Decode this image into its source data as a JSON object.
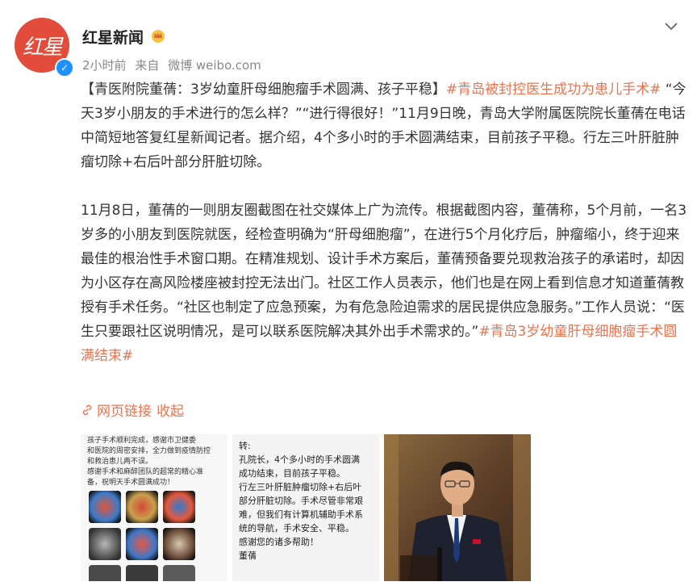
{
  "post": {
    "author": "红星新闻",
    "avatar_text": "红星",
    "time": "2小时前",
    "source_prefix": "来自",
    "source": "微博 weibo.com",
    "title_line": "【青医附院董蒨：3岁幼童肝母细胞瘤手术圆满、孩子平稳】",
    "hashtag1": "#青岛被封控医生成功为患儿手术#",
    "para1_rest": " “今天3岁小朋友的手术进行的怎么样？”“进行得很好！”11月9日晚，青岛大学附属医院院长董蒨在电话中简短地答复红星新闻记者。据介绍，4个多小时的手术圆满结束，目前孩子平稳。行左三叶肝脏肿瘤切除+右后叶部分肝脏切除。",
    "para2": "11月8日，董蒨的一则朋友圈截图在社交媒体上广为流传。根据截图内容，董蒨称，5个月前，一名3岁多的小朋友到医院就医，经检查明确为“肝母细胞瘤”，在进行5个月化疗后，肿瘤缩小，终于迎来最佳的根治性手术窗口期。在精准规划、设计手术方案后，董蒨预备要兑现救治孩子的承诺时，却因为小区存在高风险楼座被封控无法出门。社区工作人员表示，他们也是在网上看到信息才知道董蒨教授有手术任务。“社区也制定了应急预案，为有危急险迫需求的居民提供应急服务。”工作人员说：“医生只要跟社区说明情况，是可以联系医院解决其外出手术需求的。”",
    "hashtag2": "#青岛3岁幼童肝母细胞瘤手术圆满结束#",
    "link_label": "网页链接",
    "collapse_label": "收起"
  },
  "images": {
    "img1_text": [
      "孩子手术顺利完成，感谢市卫健委",
      "和医院的周密安排，全力做到疫情防控",
      "和救治患儿两不误。",
      "感谢手术和麻醉团队的超常的精心准",
      "备，祝明天手术圆满成功！"
    ],
    "img2_text": [
      "转:",
      "孔院长，4个多小时的手术圆满",
      "成功结束，目前孩子平稳。",
      "行左三叶肝脏肿瘤切除+右后叶",
      "部分肝脏切除。手术尽管非常艰",
      "难，但我们有计算机辅助手术系",
      "统的导航，手术安全、平稳。",
      "感谢您的诸多帮助！",
      "董蒨"
    ]
  },
  "colors": {
    "accent": "#eb7350",
    "verified": "#1e90ff",
    "avatar_bg": "#e34b3a"
  }
}
